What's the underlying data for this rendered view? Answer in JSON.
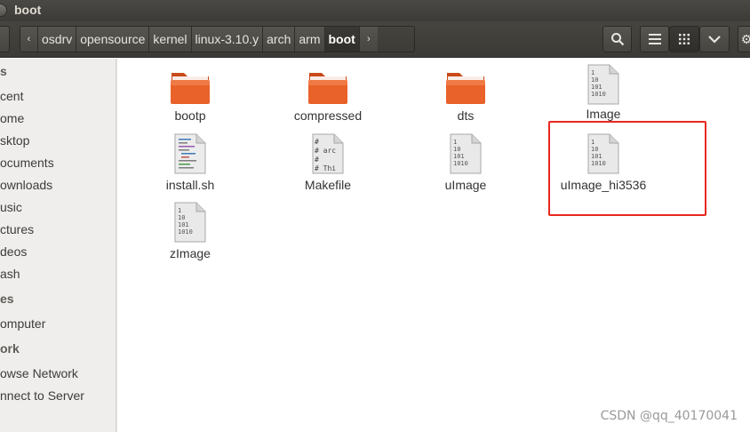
{
  "window": {
    "title": "boot"
  },
  "breadcrumb": [
    "osdrv",
    "opensource",
    "kernel",
    "linux-3.10.y",
    "arch",
    "arm",
    "boot"
  ],
  "sidebar": {
    "sections": [
      {
        "label": "s",
        "items": [
          "cent",
          "ome",
          "sktop",
          "ocuments",
          "ownloads",
          "usic",
          "ctures",
          "deos",
          "ash"
        ]
      },
      {
        "label": "es",
        "items": [
          "omputer"
        ]
      },
      {
        "label": "ork",
        "items": [
          "owse Network",
          "nnect to Server"
        ]
      }
    ]
  },
  "files": [
    {
      "name": "bootp",
      "type": "folder"
    },
    {
      "name": "compressed",
      "type": "folder"
    },
    {
      "name": "dts",
      "type": "folder"
    },
    {
      "name": "Image",
      "type": "binary"
    },
    {
      "name": "install.sh",
      "type": "script"
    },
    {
      "name": "Makefile",
      "type": "text"
    },
    {
      "name": "uImage",
      "type": "binary"
    },
    {
      "name": "uImage_hi3536",
      "type": "binary",
      "highlighted": true
    },
    {
      "name": "zImage",
      "type": "binary"
    }
  ],
  "binary_icon_lines": [
    "1",
    "10",
    "101",
    "1010"
  ],
  "makefile_icon_lines": [
    "#",
    "# arc",
    "#",
    "# Thi"
  ],
  "colors": {
    "highlight": "#e8281f",
    "folder": "#e8622a",
    "toolbar": "#3c3b37"
  },
  "watermark": "CSDN @qq_40170041"
}
